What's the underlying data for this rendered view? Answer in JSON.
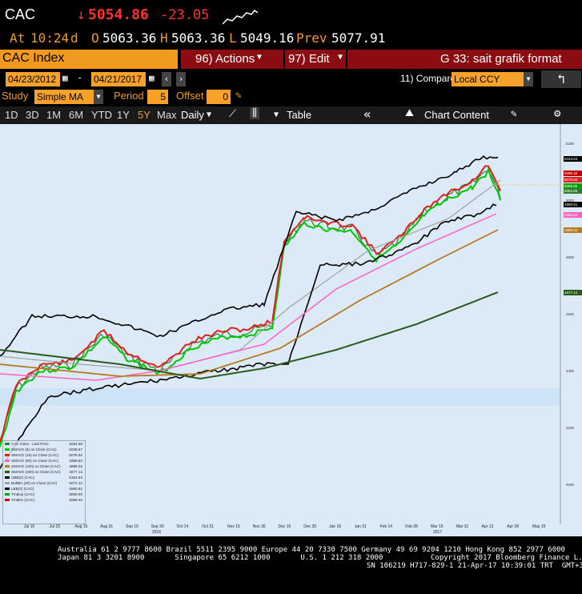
{
  "quote": {
    "ticker": "CAC",
    "arrow": "↓",
    "last": "5054.86",
    "change": "-23.05",
    "time_label": "At",
    "time": "10:24",
    "time_suffix": "d",
    "open_label": "O",
    "open": "5063.36",
    "high_label": "H",
    "high": "5063.36",
    "low_label": "L",
    "low": "5049.16",
    "prev_label": "Prev",
    "prev": "5077.91"
  },
  "toolbar": {
    "index_name": "CAC Index",
    "actions": "96) Actions",
    "edit": "97) Edit",
    "title": "G 33: sait grafik format"
  },
  "range": {
    "start": "04/23/2012",
    "end": "04/21/2017",
    "compare_label": "11) Compare",
    "compare_value": "Local CCY"
  },
  "study": {
    "label": "Study",
    "value": "Simple MA",
    "period_label": "Period",
    "period": "5",
    "offset_label": "Offset",
    "offset": "0"
  },
  "periods": [
    "1D",
    "3D",
    "1M",
    "6M",
    "YTD",
    "1Y",
    "5Y",
    "Max"
  ],
  "active_period": "5Y",
  "frequency": "Daily",
  "table_label": "Table",
  "chart_content_label": "Chart Content",
  "legend": [
    {
      "label": "CAC Index - Last Price",
      "value": "5054.86",
      "color": "#2f7d2f"
    },
    {
      "label": "SMAVG (5) on Close (CAC)",
      "value": "5039.57",
      "color": "#00c800"
    },
    {
      "label": "SMAVG (10) on Close (CAC)",
      "value": "5076.50",
      "color": "#e02020"
    },
    {
      "label": "SMAVG (60) on Close (CAC)",
      "value": "4958.84",
      "color": "#ff60c0"
    },
    {
      "label": "SMAVG (100) on Close (CAC)",
      "value": "4898.02",
      "color": "#b87a20"
    },
    {
      "label": "SMAVG (200) on Close (CAC)",
      "value": "4677.14",
      "color": "#2a5a1a"
    },
    {
      "label": "UBB(2) (CAC)",
      "value": "5153.63",
      "color": "#000000"
    },
    {
      "label": "BollMA (20) on Close (CAC)",
      "value": "5072.12",
      "color": "#a0a0a0"
    },
    {
      "label": "LBB(2) (CAC)",
      "value": "4990.61",
      "color": "#000000"
    },
    {
      "label": "TrndUp (CAC)",
      "value": "5059.90",
      "color": "#00a000"
    },
    {
      "label": "TrndDn (CAC)",
      "value": "5099.40",
      "color": "#c00000"
    }
  ],
  "x_labels": [
    "Jul 15",
    "Jul 29",
    "Aug 15",
    "Aug 31",
    "Sep 15",
    "Sep 30",
    "Oct 14",
    "Oct 31",
    "Nov 15",
    "Nov 30",
    "Dec 15",
    "Dec 30",
    "Jan 16",
    "Jan 31",
    "Feb 14",
    "Feb 28",
    "Mar 15",
    "Mar 31",
    "Apr 13",
    "Apr 28",
    "May 15"
  ],
  "x_year_labels": [
    "2016",
    "2017"
  ],
  "y_labels": [
    "5200",
    "5000",
    "4800",
    "4600",
    "4400",
    "4200",
    "4000"
  ],
  "price_tags": [
    {
      "value": "5153.63",
      "color": "#000000"
    },
    {
      "value": "5099.40",
      "color": "#c00000"
    },
    {
      "value": "5076.50",
      "color": "#e02020"
    },
    {
      "value": "5059.90",
      "color": "#00a000"
    },
    {
      "value": "5054.86",
      "color": "#2f7d2f"
    },
    {
      "value": "4990.61",
      "color": "#000000"
    },
    {
      "value": "4958.84",
      "color": "#ff60c0"
    },
    {
      "value": "4898.02",
      "color": "#b87a20"
    },
    {
      "value": "4677.14",
      "color": "#2a5a1a"
    }
  ],
  "footer": {
    "line1": "Australia 61 2 9777 8600 Brazil 5511 2395 9000 Europe 44 20 7330 7500 Germany 49 69 9204 1210 Hong Kong 852 2977 6000",
    "line2": "Japan 81 3 3201 8900       Singapore 65 6212 1000       U.S. 1 212 318 2000           Copyright 2017 Bloomberg Finance L.P.",
    "line3": "SN 106219 H717-829-1 21-Apr-17 10:39:01 TRT  GMT+3:00"
  }
}
